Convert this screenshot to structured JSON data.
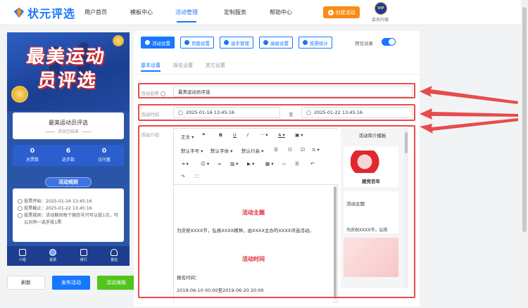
{
  "nav": {
    "logo": "状元评选",
    "items": [
      "用户首页",
      "模板中心",
      "活动管理",
      "定制服务",
      "帮助中心"
    ],
    "create_button": "创建活动",
    "vip_badge": "VIP",
    "vip_label": "会员升级"
  },
  "preview": {
    "banner_line1": "最美运动",
    "banner_line2": "员评选",
    "title": "最美运动员评选",
    "status": "活动已结束",
    "stats": [
      {
        "value": "0",
        "label": "总票数"
      },
      {
        "value": "6",
        "label": "选手数"
      },
      {
        "value": "0",
        "label": "访问量"
      }
    ],
    "rules_button": "活动规则",
    "rules": [
      "投票开始：2025-01-16 13:45:16",
      "投票截止：2025-01-22 13:45:16",
      "投票规则：活动期间每个微信号只可以投1次，可以对同一选手投1票"
    ],
    "tabbar": [
      "介绍",
      "投票",
      "排行",
      "报名"
    ]
  },
  "actions": {
    "refresh": "刷新",
    "publish": "发布活动",
    "poster": "活动海报"
  },
  "toolbar_tabs": [
    "活动设置",
    "页面设置",
    "选手管理",
    "高级设置",
    "投票统计"
  ],
  "preview_effect": "预览效果",
  "subtabs": [
    "基本设置",
    "报名设置",
    "其它设置"
  ],
  "form": {
    "name_label": "活动名称",
    "name_value": "最美运动员评选",
    "time_label": "活动时间",
    "start_time": "2025-01-16 13:45:16",
    "to_label": "至",
    "end_time": "2025-01-22 13:45:16",
    "intro_label": "活动介绍"
  },
  "editor": {
    "toolbar": [
      "正文",
      "B",
      "U",
      "I",
      "A",
      "默认字号",
      "默认字体",
      "默认行高"
    ],
    "heading1": "活动主题",
    "para1": "为庆祝XXXX节，弘扬XXXX精神，由XXXX主办的XXXX评选活动。",
    "heading2": "活动时间",
    "para2": "报名时间：",
    "para3": "2019-06-10 00:00至2019-06-20 20:00"
  },
  "templates": {
    "title": "活动简介模板",
    "card1_text": "建党百年",
    "card2_heading": "活动主题",
    "card2_text": "为庆祝XXXX节，弘扬"
  },
  "colors": {
    "primary": "#1677ff",
    "orange": "#fa8c16",
    "green": "#52c41a",
    "highlight": "#e74c4c",
    "banner": "#2a56a8"
  }
}
